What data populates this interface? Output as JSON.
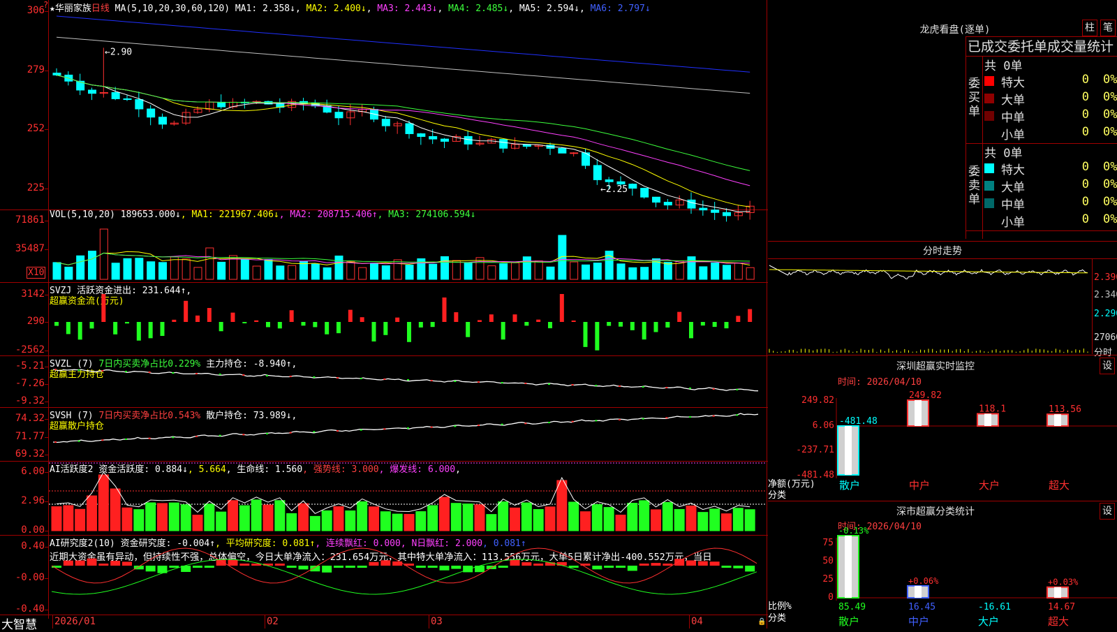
{
  "stock": {
    "name": "★华丽家族",
    "period": "日线",
    "ma_header": [
      {
        "t": "MA(5,10,20,30,60,120) ",
        "c": "white"
      },
      {
        "t": "MA1: 2.358↓",
        "c": "white"
      },
      {
        "t": ", ",
        "c": "white"
      },
      {
        "t": "MA2: 2.400↓",
        "c": "yellow"
      },
      {
        "t": ", ",
        "c": "white"
      },
      {
        "t": "MA3: 2.443↓",
        "c": "mag"
      },
      {
        "t": ", ",
        "c": "white"
      },
      {
        "t": "MA4: 2.485↓",
        "c": "green"
      },
      {
        "t": ", ",
        "c": "white"
      },
      {
        "t": "MA5: 2.594↓",
        "c": "white"
      },
      {
        "t": ", ",
        "c": "white"
      },
      {
        "t": "MA6: 2.797↓",
        "c": "blue"
      }
    ],
    "price_ticks": [
      "306",
      "279",
      "252",
      "225"
    ],
    "high_label": "←2.90",
    "low_label": "←2.25"
  },
  "vol": {
    "header": [
      {
        "t": "VOL(5,10,20) ",
        "c": "white"
      },
      {
        "t": "189653.000↓",
        "c": "white"
      },
      {
        "t": ", MA1: 221967.406↓",
        "c": "yellow"
      },
      {
        "t": ", MA2: 208715.406↑",
        "c": "mag"
      },
      {
        "t": ", MA3: 274106.594↓",
        "c": "green"
      }
    ],
    "ticks": [
      "71861",
      "35487"
    ],
    "unit": "X10"
  },
  "svzj": {
    "line1": [
      {
        "t": "SVZJ  活跃资金进出: 231.644↑",
        "c": "white"
      },
      {
        "t": ",",
        "c": "white"
      }
    ],
    "line2": "超赢资金流(万元)",
    "ticks": [
      "3142",
      "290",
      "-2562"
    ]
  },
  "svzl": {
    "line1": [
      {
        "t": "SVZL (7) ",
        "c": "white"
      },
      {
        "t": "7日内买卖净占比0.229%",
        "c": "green"
      },
      {
        "t": " 主力持仓: -8.940↑,",
        "c": "white"
      }
    ],
    "line2": "超赢主力持仓",
    "ticks": [
      "-5.21",
      "-7.26",
      "-9.32"
    ]
  },
  "svsh": {
    "line1": [
      {
        "t": "SVSH (7) ",
        "c": "white"
      },
      {
        "t": "7日内买卖净占比0.543%",
        "c": "red"
      },
      {
        "t": " 散户持仓: 73.989↓,",
        "c": "white"
      }
    ],
    "line2": "超赢散户持仓",
    "ticks": [
      "74.32",
      "71.77",
      "69.32"
    ]
  },
  "ai1": {
    "line1": [
      {
        "t": "AI活跃度2 ",
        "c": "white"
      },
      {
        "t": "资金活跃度: 0.884↓",
        "c": "white"
      },
      {
        "t": ", 5.664",
        "c": "yellow"
      },
      {
        "t": ", 生命线: 1.560",
        "c": "white"
      },
      {
        "t": ", 强势线: 3.000",
        "c": "red"
      },
      {
        "t": ", 爆发线: 6.000",
        "c": "mag"
      },
      {
        "t": ",",
        "c": "white"
      }
    ],
    "ticks": [
      "6.00",
      "2.96",
      "0.00"
    ]
  },
  "ai2": {
    "line1": [
      {
        "t": "AI研究度2(10) ",
        "c": "white"
      },
      {
        "t": "资金研究度: -0.004↑",
        "c": "white"
      },
      {
        "t": ", 平均研究度: 0.081↑",
        "c": "yellow"
      },
      {
        "t": ", 连续飘红: 0.000",
        "c": "mag"
      },
      {
        "t": ", N日飘红: 2.000",
        "c": "mag"
      },
      {
        "t": ", 0.081↑",
        "c": "blue"
      }
    ],
    "line2": "近期大资金虽有异动，但持续性不强，总体偏空，今日大单净流入：231.654万元，其中特大单净流入：113.556万元，大单5日累计净出-400.552万元，当日",
    "ticks": [
      "0.40",
      "-0.00",
      "-0.40"
    ]
  },
  "xaxis": {
    "brand": "大智慧",
    "months": [
      "2026/01",
      "02",
      "03",
      "04"
    ]
  },
  "right": {
    "lhkp_title": "龙虎看盘(逐单)",
    "btn_bar": "柱",
    "btn_pen": "笔",
    "order_title": "已成交委托单成交量统计",
    "buy_label": "委买单",
    "sell_label": "委卖单",
    "buy_total": "共 0单",
    "sell_total": "共 0单",
    "buy_rows": [
      {
        "name": "特大",
        "count": "0",
        "pct": "0%",
        "color": "#ff0000"
      },
      {
        "name": "大单",
        "count": "0",
        "pct": "0%",
        "color": "#900000"
      },
      {
        "name": "中单",
        "count": "0",
        "pct": "0%",
        "color": "#700000"
      },
      {
        "name": "小单",
        "count": "0",
        "pct": "0%",
        "color": "#000000"
      }
    ],
    "sell_rows": [
      {
        "name": "特大",
        "count": "0",
        "pct": "0%",
        "color": "#00ffff"
      },
      {
        "name": "大单",
        "count": "0",
        "pct": "0%",
        "color": "#008080"
      },
      {
        "name": "中单",
        "count": "0",
        "pct": "0%",
        "color": "#006868"
      },
      {
        "name": "小单",
        "count": "0",
        "pct": "0%",
        "color": "#000000"
      }
    ],
    "fenshi_title": "分时走势",
    "fenshi_ticks": [
      "2.390",
      "2.340",
      "2.290",
      "27060",
      "分时"
    ],
    "sz_title": "深圳超赢实时监控",
    "set_btn": "设",
    "sz_time": "时间: 2026/04/10",
    "sz_ticks": [
      "249.82",
      "6.06",
      "-237.71",
      "-481.48"
    ],
    "sz_ylabel1": "净额(万元)",
    "sz_ylabel2": "分类",
    "sz_cats": [
      "散户",
      "中户",
      "大户",
      "超大"
    ],
    "sz_vals": [
      "-481.48",
      "249.82",
      "118.1",
      "113.56"
    ],
    "fl_title": "深市超赢分类统计",
    "fl_time": "时间: 2026/04/10",
    "fl_ticks": [
      "75",
      "50",
      "25",
      "0"
    ],
    "fl_ylabel1": "比例%",
    "fl_ylabel2": "分类",
    "fl_top": [
      "-0.13%",
      "+0.06%",
      "",
      "+0.03%"
    ],
    "fl_bottom": [
      "85.49",
      "16.45",
      "-16.61",
      "14.67"
    ],
    "fl_cats": [
      "散户",
      "中户",
      "大户",
      "超大"
    ]
  },
  "chart_data": [
    {
      "type": "bar",
      "title": "深圳超赢实时监控",
      "categories": [
        "散户",
        "中户",
        "大户",
        "超大"
      ],
      "values": [
        -481.48,
        249.82,
        118.1,
        113.56
      ],
      "ylabel": "净额(万元)",
      "ylim": [
        -481.48,
        249.82
      ]
    },
    {
      "type": "bar",
      "title": "深市超赢分类统计",
      "categories": [
        "散户",
        "中户",
        "大户",
        "超大"
      ],
      "values": [
        85.49,
        16.45,
        -16.61,
        14.67
      ],
      "ylabel": "比例%",
      "ylim": [
        0,
        75
      ]
    }
  ]
}
